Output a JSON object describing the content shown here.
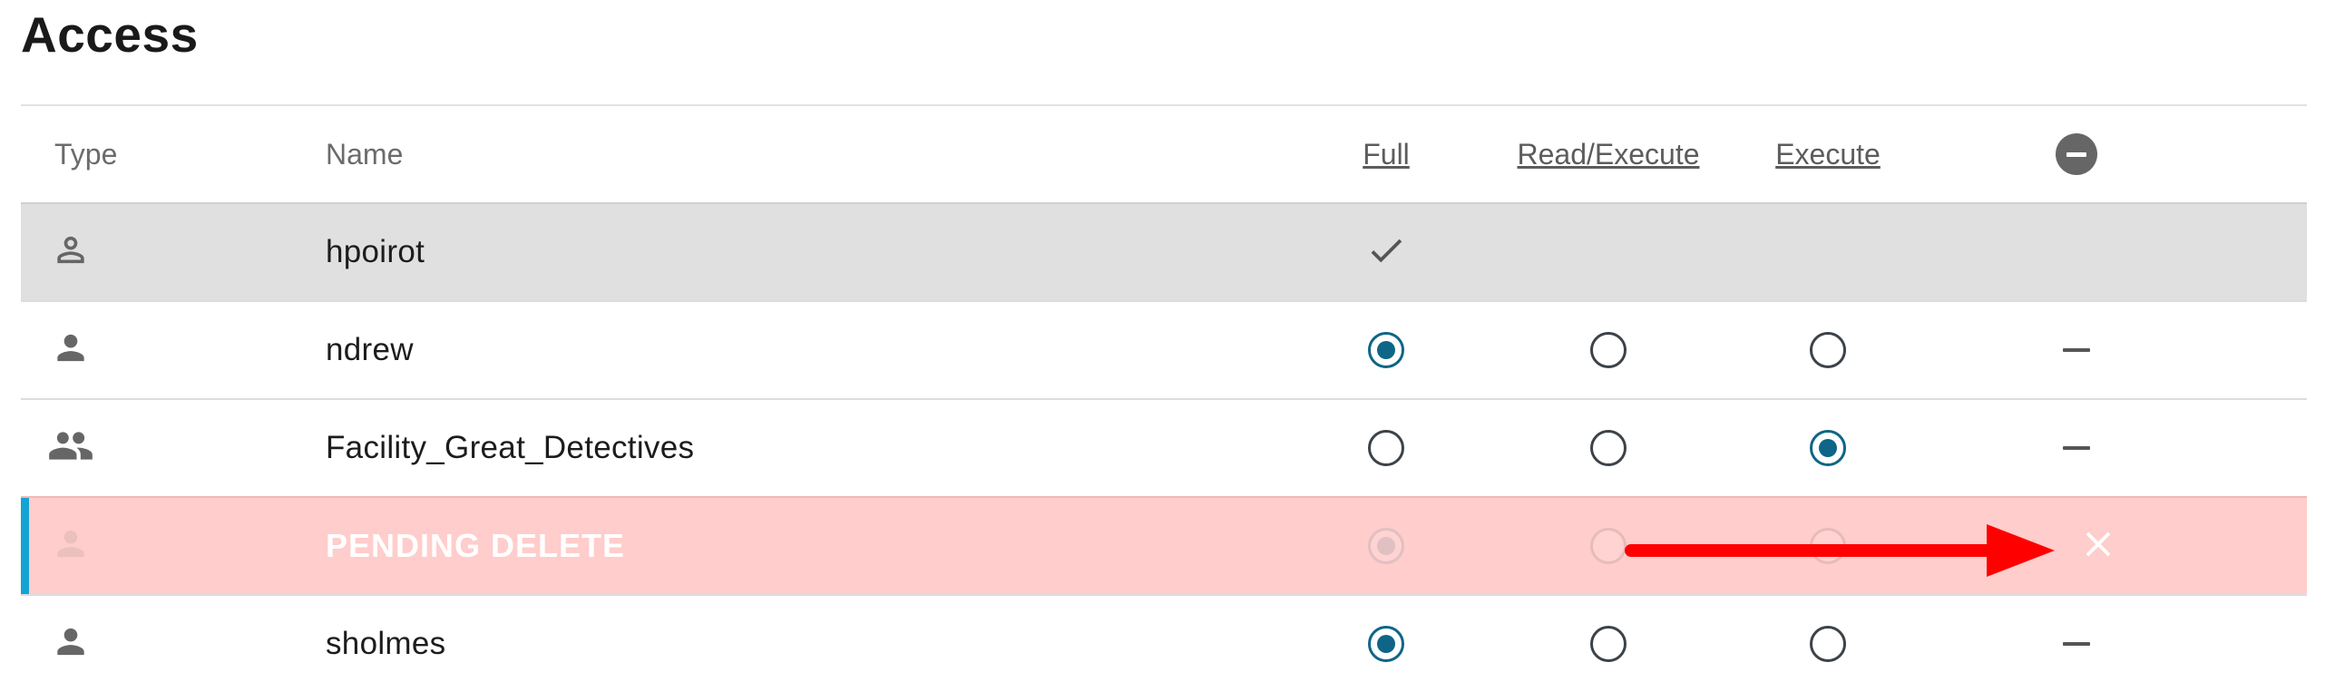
{
  "page": {
    "title": "Access"
  },
  "header": {
    "type": "Type",
    "name": "Name",
    "full": "Full",
    "read_execute": "Read/Execute",
    "execute": "Execute",
    "remove_all_icon": "minus-circle-icon"
  },
  "rows": [
    {
      "type_icon": "person-outline-icon",
      "name": "hpoirot",
      "selected": true,
      "access": "full",
      "full_indicator": "checkmark-icon"
    },
    {
      "type_icon": "person-icon",
      "name": "ndrew",
      "access": "full",
      "remove_icon": "dash-icon"
    },
    {
      "type_icon": "group-icon",
      "name": "Facility_Great_Detectives",
      "access": "execute",
      "remove_icon": "dash-icon"
    },
    {
      "type_icon": "person-icon",
      "name": "PENDING DELETE",
      "status": "pending_delete",
      "access": "full",
      "remove_icon": "close-icon"
    },
    {
      "type_icon": "person-icon",
      "name": "sholmes",
      "access": "full",
      "remove_icon": "dash-icon"
    }
  ],
  "annotation": {
    "type": "arrow",
    "color": "#ff0000",
    "points_to": "close-icon"
  },
  "colors": {
    "selected_row": "#e0e0e0",
    "pending_row": "#ffcdcb",
    "pending_accent": "#13a3d4",
    "radio_selected": "#0e6587",
    "annotation_arrow": "#ff0000"
  }
}
